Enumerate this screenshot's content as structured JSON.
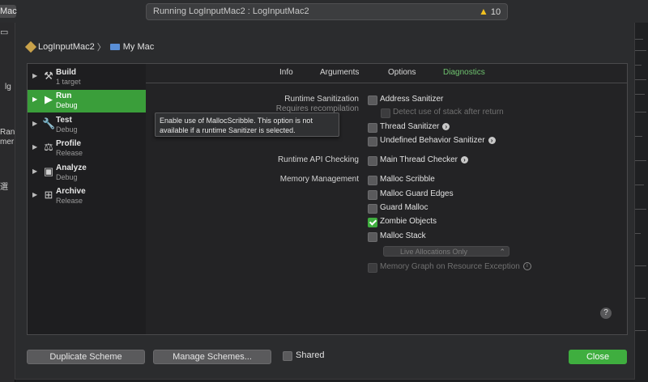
{
  "xcode": {
    "mac_label": "Mac",
    "status_text": "Running LogInputMac2 : LogInputMac2",
    "warning_count": "10",
    "left_fragments": [
      "lg",
      "Ran",
      "mer",
      "選"
    ]
  },
  "breadcrumb": {
    "target": "LogInputMac2",
    "separator": "〉",
    "device": "My Mac"
  },
  "actions": [
    {
      "name": "Build",
      "sub": "1 target",
      "icon": "hammer-icon",
      "glyph": "⚒"
    },
    {
      "name": "Run",
      "sub": "Debug",
      "icon": "play-icon",
      "glyph": "▶"
    },
    {
      "name": "Test",
      "sub": "Debug",
      "icon": "wrench-icon",
      "glyph": "🔧"
    },
    {
      "name": "Profile",
      "sub": "Release",
      "icon": "instruments-icon",
      "glyph": "⚖"
    },
    {
      "name": "Analyze",
      "sub": "Debug",
      "icon": "analyze-icon",
      "glyph": "▣"
    },
    {
      "name": "Archive",
      "sub": "Release",
      "icon": "archive-icon",
      "glyph": "⊞"
    }
  ],
  "tabs": [
    "Info",
    "Arguments",
    "Options",
    "Diagnostics"
  ],
  "active_tab": "Diagnostics",
  "sections": {
    "runtime_sanitization": "Runtime Sanitization",
    "requires_recompilation": "Requires recompilation",
    "runtime_api_checking": "Runtime API Checking",
    "memory_management": "Memory Management"
  },
  "options": {
    "address_sanitizer": {
      "label": "Address Sanitizer",
      "checked": false
    },
    "detect_stack": {
      "label": "Detect use of stack after return",
      "checked": false,
      "disabled": true
    },
    "thread_sanitizer": {
      "label": "Thread Sanitizer",
      "checked": false
    },
    "ub_sanitizer": {
      "label": "Undefined Behavior Sanitizer",
      "checked": false
    },
    "main_thread_checker": {
      "label": "Main Thread Checker",
      "checked": false
    },
    "malloc_scribble": {
      "label": "Malloc Scribble",
      "checked": false
    },
    "malloc_guard_edges": {
      "label": "Malloc Guard Edges",
      "checked": false
    },
    "guard_malloc": {
      "label": "Guard Malloc",
      "checked": false
    },
    "zombie_objects": {
      "label": "Zombie Objects",
      "checked": true
    },
    "malloc_stack": {
      "label": "Malloc Stack",
      "checked": false
    },
    "memory_graph": {
      "label": "Memory Graph on Resource Exception",
      "checked": false,
      "disabled": true
    }
  },
  "malloc_stack_select": "Live Allocations Only",
  "tooltip": "Enable use of MallocScribble. This option is not available if a runtime Sanitizer is selected.",
  "help": "?",
  "footer": {
    "duplicate": "Duplicate Scheme",
    "manage": "Manage Schemes...",
    "shared": "Shared",
    "close": "Close"
  },
  "colors": {
    "accent_green": "#3fae3f",
    "selection_green": "#3a9e3a",
    "warning": "#f0c020"
  }
}
